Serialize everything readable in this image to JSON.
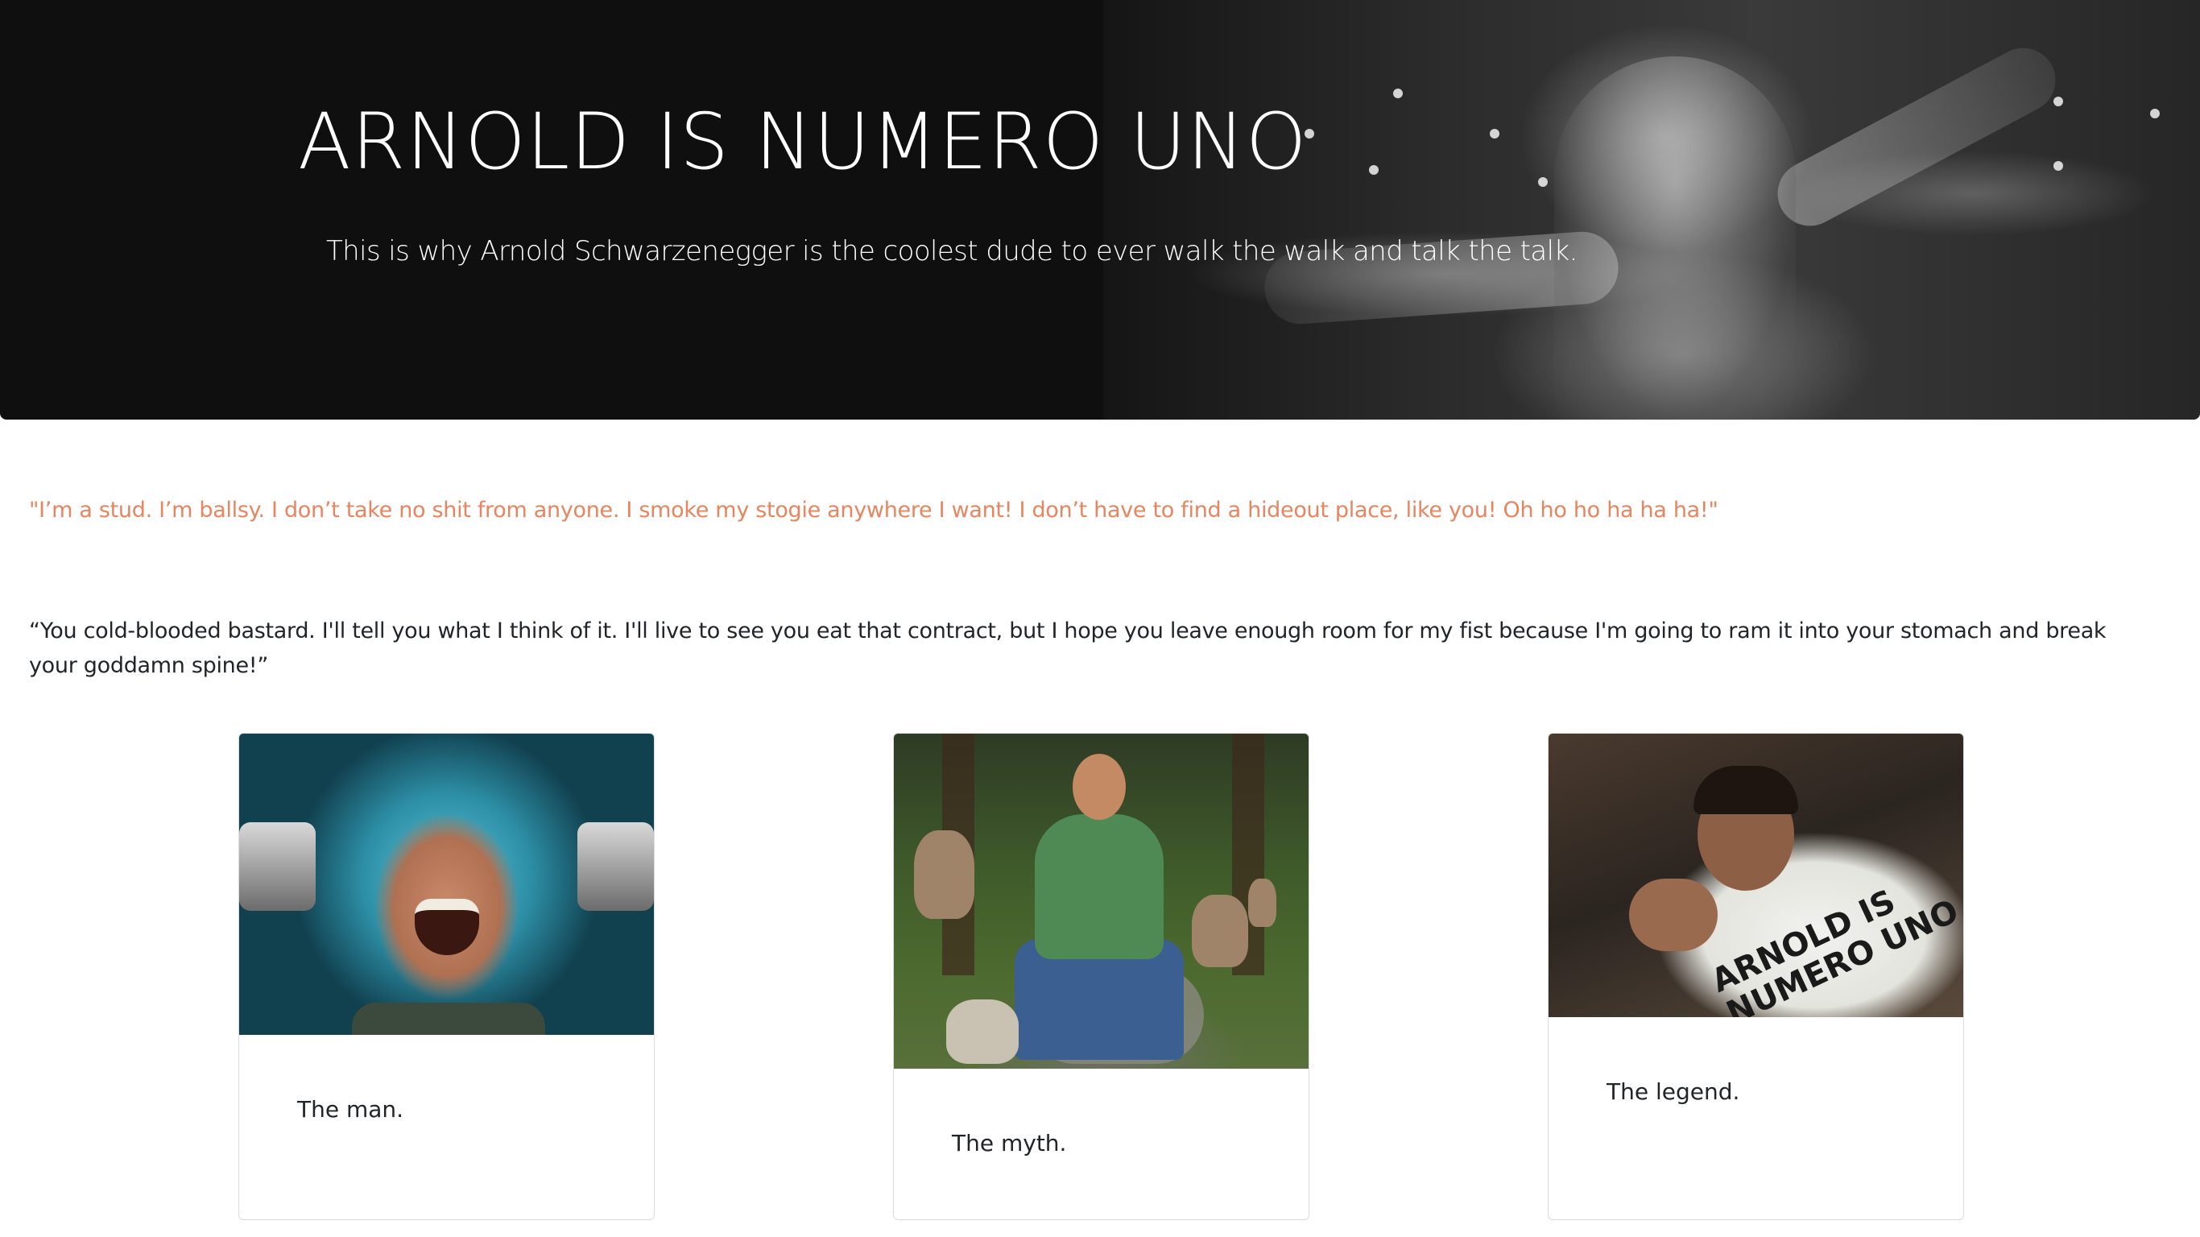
{
  "hero": {
    "title": "ARNOLD IS NUMERO UNO",
    "subtitle": "This is why Arnold Schwarzenegger is the coolest dude to ever walk the walk and talk the talk.",
    "background_color": "#0f0f0f",
    "title_color": "#ffffff"
  },
  "quotes": {
    "first": "\"I’m a stud. I’m ballsy. I don’t take no shit from anyone. I smoke my stogie anywhere I want! I don’t have to find a hideout place, like you! Oh ho ho ha ha ha!\"",
    "first_color": "#e8855f",
    "second": "“You cold-blooded bastard. I'll tell you what I think of it. I'll live to see you eat that contract, but I hope you leave enough room for my fist because I'm going to ram it into your stomach and break your goddamn spine!”",
    "second_color": "#212529"
  },
  "cards": [
    {
      "caption": "The man."
    },
    {
      "caption": "The myth."
    },
    {
      "caption": "The legend.",
      "shirt_print": "ARNOLD IS\nNUMERO UNO"
    }
  ]
}
